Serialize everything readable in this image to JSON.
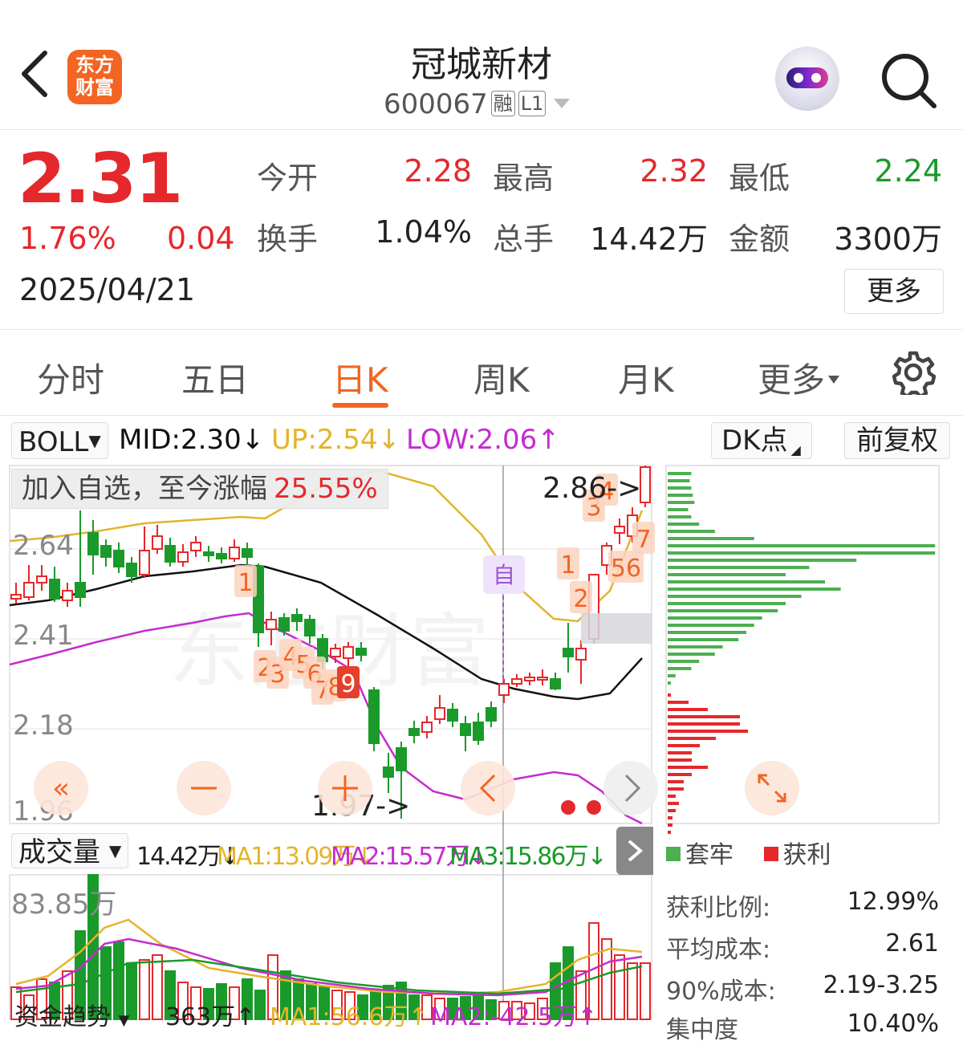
{
  "header": {
    "logo_text_1": "东方",
    "logo_text_2": "财富",
    "stock_name": "冠城新材",
    "stock_code": "600067",
    "tag_rong": "融",
    "tag_level": "L1"
  },
  "quote": {
    "price": "2.31",
    "change_pct": "1.76%",
    "change": "0.04",
    "date": "2025/04/21",
    "open_label": "今开",
    "open": "2.28",
    "high_label": "最高",
    "high": "2.32",
    "low_label": "最低",
    "low": "2.24",
    "turnover_label": "换手",
    "turnover": "1.04%",
    "volume_label": "总手",
    "volume": "14.42万",
    "amount_label": "金额",
    "amount": "3300万",
    "more": "更多"
  },
  "tabs": [
    {
      "label": "分时"
    },
    {
      "label": "五日"
    },
    {
      "label": "日K"
    },
    {
      "label": "周K"
    },
    {
      "label": "月K"
    },
    {
      "label": "更多"
    }
  ],
  "indicator": {
    "name": "BOLL",
    "mid": "MID:2.30↓",
    "up": "UP:2.54↓",
    "low": "LOW:2.06↑",
    "dk": "DK点",
    "fq": "前复权"
  },
  "banner": {
    "text": "加入自选，至今涨幅",
    "value": "25.55%"
  },
  "kline": {
    "y_ticks": [
      "2.64",
      "2.41",
      "2.18",
      "1.96"
    ],
    "high_note": "2.86->",
    "low_note": "1.97->",
    "self_mark": "自",
    "watermark": "东方财富",
    "signal_labels": [
      "1",
      "2",
      "3",
      "4",
      "5",
      "6",
      "7",
      "8",
      "9",
      "1",
      "2",
      "3",
      "4",
      "56",
      "7"
    ],
    "colors": {
      "up": "#e5282b",
      "down": "#1a9a2a",
      "mid": "#111111",
      "upper": "#e3b42b",
      "lower": "#c42ccf"
    }
  },
  "chip": {
    "legend_trapped": "套牢",
    "legend_profit": "获利",
    "profit_ratio_label": "获利比例:",
    "profit_ratio": "12.99%",
    "avg_cost_label": "平均成本:",
    "avg_cost": "2.61",
    "cost90_label": "90%成本:",
    "cost90": "2.19-3.25",
    "concentration_label": "集中度",
    "concentration": "10.40%"
  },
  "volume": {
    "selector": "成交量",
    "current": "14.42万↓",
    "ma1": "MA1:13.09万↓",
    "ma2": "MA2:15.57万↓",
    "ma3": "MA3:15.86万↓",
    "y_tick": "83.85万"
  },
  "fund": {
    "selector": "资金趋势",
    "current": "363万↑",
    "ma1": "MA1:56.6万↑",
    "ma2": "MA2:-42.5万↑"
  },
  "nav_buttons": [
    "pan-left",
    "zoom-out",
    "zoom-in",
    "prev",
    "next"
  ]
}
